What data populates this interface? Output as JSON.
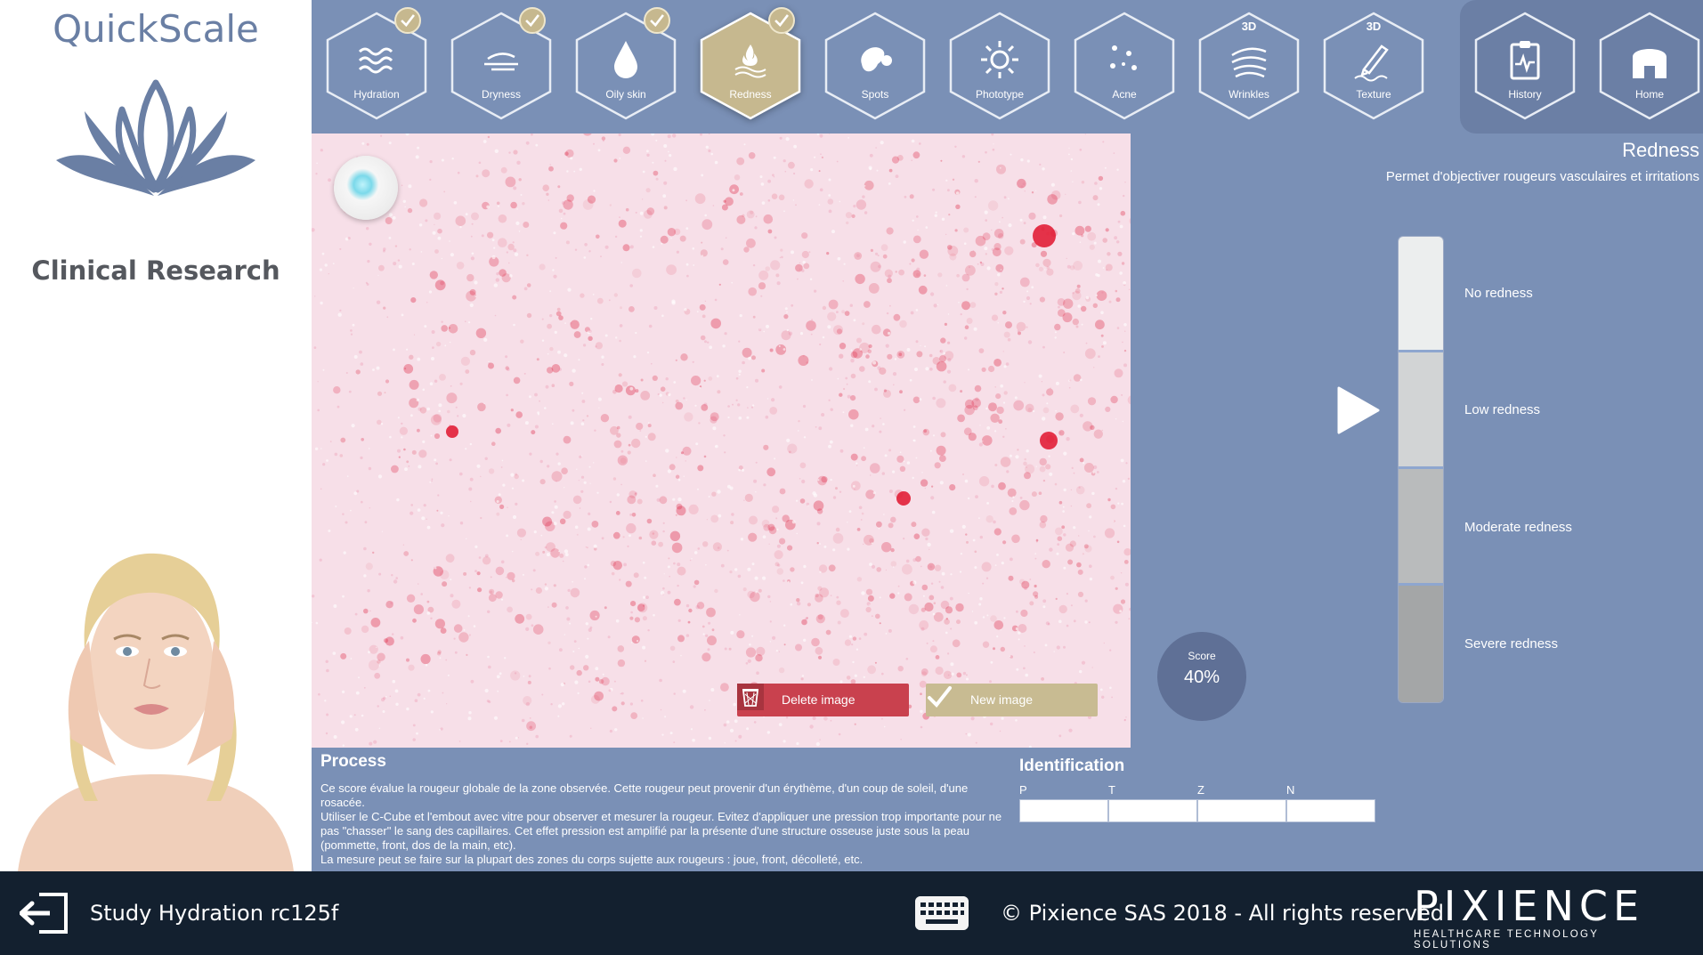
{
  "brand": {
    "name": "QuickScale",
    "subtitle": "Clinical Research"
  },
  "toolbar": {
    "tools": [
      {
        "label": "Hydration",
        "icon": "waves-icon",
        "checked": true,
        "active": false,
        "badge": ""
      },
      {
        "label": "Dryness",
        "icon": "dryness-icon",
        "checked": true,
        "active": false,
        "badge": ""
      },
      {
        "label": "Oily skin",
        "icon": "drop-icon",
        "checked": true,
        "active": false,
        "badge": ""
      },
      {
        "label": "Redness",
        "icon": "redness-icon",
        "checked": true,
        "active": true,
        "badge": ""
      },
      {
        "label": "Spots",
        "icon": "spots-icon",
        "checked": false,
        "active": false,
        "badge": ""
      },
      {
        "label": "Phototype",
        "icon": "sun-icon",
        "checked": false,
        "active": false,
        "badge": ""
      },
      {
        "label": "Acne",
        "icon": "acne-icon",
        "checked": false,
        "active": false,
        "badge": ""
      },
      {
        "label": "Wrinkles",
        "icon": "wrinkles-icon",
        "checked": false,
        "active": false,
        "badge": "3D"
      },
      {
        "label": "Texture",
        "icon": "texture-icon",
        "checked": false,
        "active": false,
        "badge": "3D"
      }
    ],
    "nav": [
      {
        "label": "History",
        "icon": "clipboard-icon"
      },
      {
        "label": "Home",
        "icon": "home-icon"
      }
    ]
  },
  "image_actions": {
    "delete_label": "Delete image",
    "new_label": "New image"
  },
  "panel": {
    "title": "Redness",
    "description": "Permet d'objectiver rougeurs vasculaires et irritations",
    "scale": [
      "No redness",
      "Low redness",
      "Moderate redness",
      "Severe redness"
    ],
    "score_label": "Score",
    "score_value": "40%"
  },
  "process": {
    "title": "Process",
    "paragraphs": [
      "Ce score évalue la rougeur globale de la zone observée. Cette rougeur peut provenir d'un érythème, d'un coup de soleil, d'une rosacée.",
      "Utiliser le C-Cube et l'embout avec vitre pour observer et mesurer la rougeur. Evitez d'appliquer une pression trop importante pour ne pas \"chasser\" le sang des capillaires. Cet effet pression est amplifié par la présente d'une structure osseuse juste sous la peau (pommette, front, dos de la main, etc).",
      "La mesure peut se faire sur la plupart des zones du corps sujette aux rougeurs : joue, front, décolleté, etc."
    ]
  },
  "identification": {
    "title": "Identification",
    "fields": [
      {
        "label": "P",
        "value": ""
      },
      {
        "label": "T",
        "value": ""
      },
      {
        "label": "Z",
        "value": ""
      },
      {
        "label": "N",
        "value": ""
      }
    ]
  },
  "footer": {
    "study": "Study Hydration rc125f",
    "copyright": "© Pixience SAS 2018 - All rights reserved",
    "logo": "PIXIENCE",
    "tagline": "HEALTHCARE TECHNOLOGY SOLUTIONS"
  },
  "colors": {
    "toolbar": "#7a90b6",
    "active_tool": "#c6b88f",
    "delete": "#c9414e",
    "footer": "#13202f"
  }
}
